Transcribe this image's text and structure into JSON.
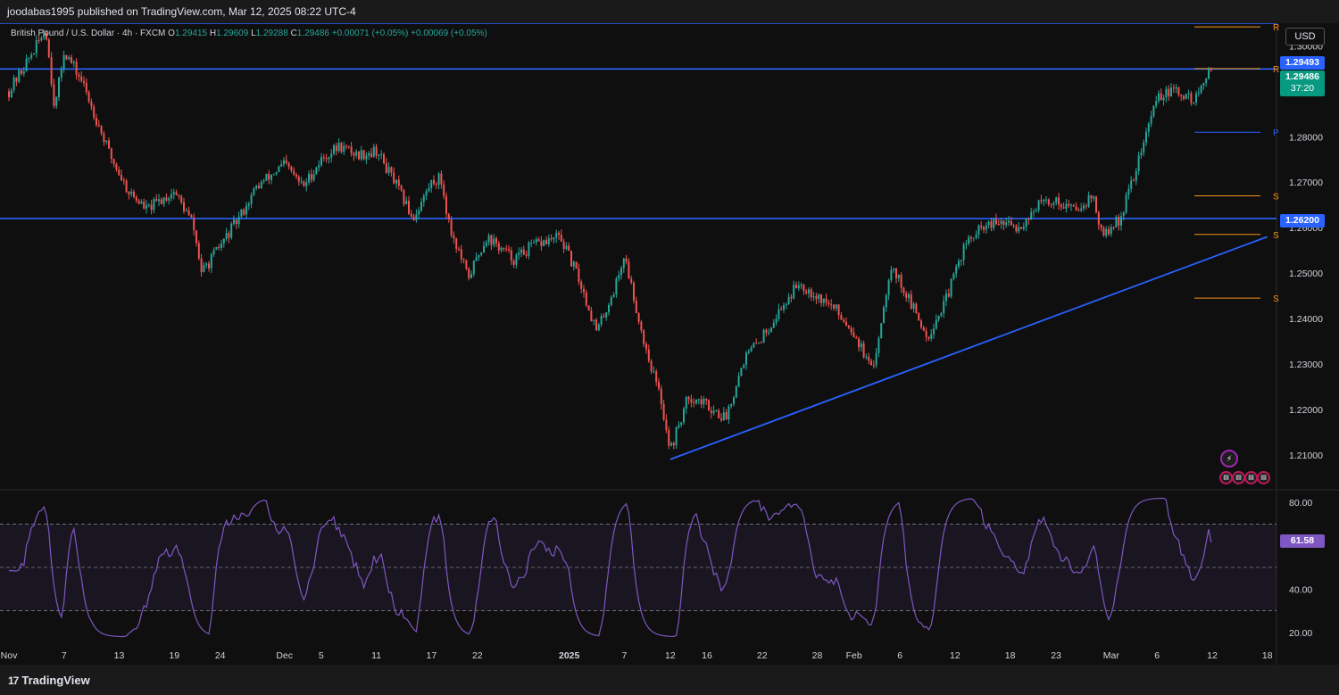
{
  "header": {
    "publisher_line": "joodabas1995 published on TradingView.com, Mar 12, 2025 08:22 UTC-4"
  },
  "legend": {
    "symbol": "British Pound / U.S. Dollar · 4h · FXCM",
    "o_label": "O",
    "o": "1.29415",
    "h_label": "H",
    "h": "1.29609",
    "l_label": "L",
    "l": "1.29288",
    "c_label": "C",
    "c": "1.29486",
    "change": "+0.00071 (+0.05%)",
    "change2": "+0.00069 (+0.05%)"
  },
  "currency_button": "USD",
  "price_tags": {
    "upper_line": "1.29493",
    "last_price": "1.29486",
    "countdown": "37:20",
    "support_line": "1.26200",
    "rsi_value": "61.58"
  },
  "footer": {
    "brand": "TradingView",
    "logo_icon": "tradingview-logo-icon"
  },
  "colors": {
    "up": "#26a69a",
    "down": "#ef5350",
    "lines": "#2962ff",
    "pivots": "#f7931a",
    "rsi": "#7e57c2"
  },
  "chart_data": [
    {
      "type": "candlestick",
      "title": "British Pound / U.S. Dollar · 4h · FXCM",
      "ylim": [
        1.2025,
        1.305
      ],
      "y_ticks": [
        "1.30000",
        "1.29000",
        "1.28000",
        "1.27000",
        "1.26000",
        "1.25000",
        "1.24000",
        "1.23000",
        "1.22000",
        "1.21000"
      ],
      "x_ticks": [
        "Nov",
        "7",
        "13",
        "19",
        "24",
        "Dec",
        "5",
        "11",
        "17",
        "22",
        "2025",
        "7",
        "12",
        "16",
        "22",
        "28",
        "Feb",
        "6",
        "12",
        "18",
        "23",
        "Mar",
        "6",
        "12",
        "18"
      ],
      "price_path": [
        [
          "2024-11-01",
          1.29
        ],
        [
          "2024-11-04",
          1.3
        ],
        [
          "2024-11-05",
          1.304
        ],
        [
          "2024-11-06",
          1.286
        ],
        [
          "2024-11-07",
          1.299
        ],
        [
          "2024-11-09",
          1.292
        ],
        [
          "2024-11-12",
          1.276
        ],
        [
          "2024-11-14",
          1.268
        ],
        [
          "2024-11-16",
          1.264
        ],
        [
          "2024-11-19",
          1.268
        ],
        [
          "2024-11-21",
          1.261
        ],
        [
          "2024-11-22",
          1.25
        ],
        [
          "2024-11-24",
          1.256
        ],
        [
          "2024-11-26",
          1.262
        ],
        [
          "2024-11-28",
          1.269
        ],
        [
          "2024-12-01",
          1.274
        ],
        [
          "2024-12-03",
          1.269
        ],
        [
          "2024-12-05",
          1.275
        ],
        [
          "2024-12-07",
          1.278
        ],
        [
          "2024-12-09",
          1.276
        ],
        [
          "2024-12-11",
          1.277
        ],
        [
          "2024-12-13",
          1.27
        ],
        [
          "2024-12-15",
          1.262
        ],
        [
          "2024-12-17",
          1.27
        ],
        [
          "2024-12-18",
          1.271
        ],
        [
          "2024-12-19",
          1.26
        ],
        [
          "2024-12-21",
          1.249
        ],
        [
          "2024-12-23",
          1.258
        ],
        [
          "2024-12-26",
          1.253
        ],
        [
          "2024-12-28",
          1.256
        ],
        [
          "2024-12-31",
          1.258
        ],
        [
          "2025-01-02",
          1.249
        ],
        [
          "2025-01-04",
          1.237
        ],
        [
          "2025-01-06",
          1.247
        ],
        [
          "2025-01-07",
          1.254
        ],
        [
          "2025-01-09",
          1.236
        ],
        [
          "2025-01-11",
          1.222
        ],
        [
          "2025-01-12",
          1.211
        ],
        [
          "2025-01-14",
          1.223
        ],
        [
          "2025-01-16",
          1.221
        ],
        [
          "2025-01-18",
          1.218
        ],
        [
          "2025-01-20",
          1.231
        ],
        [
          "2025-01-22",
          1.236
        ],
        [
          "2025-01-24",
          1.242
        ],
        [
          "2025-01-26",
          1.248
        ],
        [
          "2025-01-28",
          1.245
        ],
        [
          "2025-01-30",
          1.242
        ],
        [
          "2025-02-01",
          1.237
        ],
        [
          "2025-02-03",
          1.228
        ],
        [
          "2025-02-05",
          1.252
        ],
        [
          "2025-02-07",
          1.244
        ],
        [
          "2025-02-09",
          1.236
        ],
        [
          "2025-02-11",
          1.244
        ],
        [
          "2025-02-13",
          1.256
        ],
        [
          "2025-02-15",
          1.26
        ],
        [
          "2025-02-17",
          1.261
        ],
        [
          "2025-02-19",
          1.26
        ],
        [
          "2025-02-21",
          1.265
        ],
        [
          "2025-02-23",
          1.266
        ],
        [
          "2025-02-25",
          1.264
        ],
        [
          "2025-02-27",
          1.267
        ],
        [
          "2025-02-28",
          1.258
        ],
        [
          "2025-03-02",
          1.262
        ],
        [
          "2025-03-04",
          1.275
        ],
        [
          "2025-03-06",
          1.289
        ],
        [
          "2025-03-08",
          1.29
        ],
        [
          "2025-03-10",
          1.288
        ],
        [
          "2025-03-12",
          1.2949
        ]
      ],
      "horizontal_lines": [
        1.305,
        1.29493,
        1.262
      ],
      "trendline": [
        [
          "2025-01-12",
          1.209
        ],
        [
          "2025-03-18",
          1.258
        ]
      ],
      "pivot_labels": [
        "R",
        "R",
        "P",
        "S",
        "S",
        "S"
      ],
      "legend_placement": "top-left"
    },
    {
      "type": "line",
      "title": "",
      "ylim": [
        15,
        85
      ],
      "y_ticks": [
        "80.00",
        "40.00",
        "20.00"
      ],
      "bands": [
        70,
        50,
        30
      ],
      "last_value": 61.58,
      "grid": false
    }
  ]
}
